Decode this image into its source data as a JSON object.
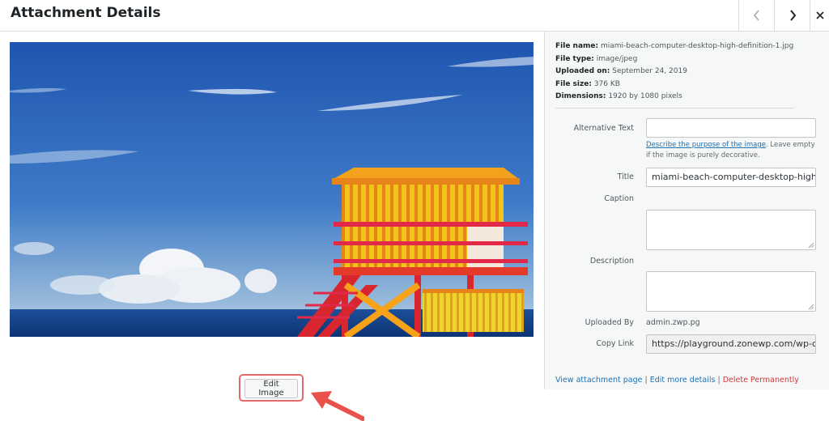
{
  "header": {
    "title": "Attachment Details",
    "prev_icon": "chevron-left-icon",
    "next_icon": "chevron-right-icon",
    "close_icon": "close-icon"
  },
  "preview": {
    "edit_label": "Edit Image"
  },
  "meta": {
    "file_name_label": "File name:",
    "file_name": "miami-beach-computer-desktop-high-definition-1.jpg",
    "file_type_label": "File type:",
    "file_type": "image/jpeg",
    "uploaded_on_label": "Uploaded on:",
    "uploaded_on": "September 24, 2019",
    "file_size_label": "File size:",
    "file_size": "376 KB",
    "dimensions_label": "Dimensions:",
    "dimensions": "1920 by 1080 pixels"
  },
  "form": {
    "alt_label": "Alternative Text",
    "alt_value": "",
    "alt_help_link": "Describe the purpose of the image",
    "alt_help_text": ". Leave empty if the image is purely decorative.",
    "title_label": "Title",
    "title_value": "miami-beach-computer-desktop-high-d",
    "caption_label": "Caption",
    "description_label": "Description",
    "uploaded_by_label": "Uploaded By",
    "uploaded_by_value": "admin.zwp.pg",
    "copy_link_label": "Copy Link",
    "copy_link_value": "https://playground.zonewp.com/wp-co"
  },
  "actions": {
    "view_page": "View attachment page",
    "sep1": " | ",
    "edit_details": "Edit more details",
    "sep2": " | ",
    "delete": "Delete Permanently"
  },
  "colors": {
    "link": "#2271b1",
    "delete": "#d63638",
    "highlight": "#e26a6a"
  }
}
